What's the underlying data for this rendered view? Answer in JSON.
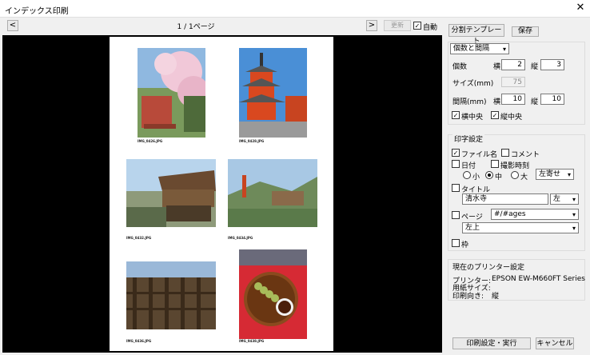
{
  "window": {
    "title": "インデックス印刷"
  },
  "toolbar": {
    "prev": "<",
    "next": ">",
    "page_info": "1 / 1ページ",
    "update": "更新",
    "auto": "自動",
    "auto_checked": true
  },
  "thumbs": [
    {
      "caption": "IMG_0426.JPG"
    },
    {
      "caption": "IMG_0428.JPG"
    },
    {
      "caption": "IMG_0432.JPG"
    },
    {
      "caption": "IMG_0434.JPG"
    },
    {
      "caption": "IMG_0436.JPG"
    },
    {
      "caption": "IMG_0438.JPG"
    }
  ],
  "panel": {
    "split_template": "分割テンプレート",
    "save": "保存",
    "mode": "個数と間隔",
    "count_label": "個数",
    "h_label": "横",
    "v_label": "縦",
    "count_h": "2",
    "count_v": "3",
    "size_label": "サイズ(mm)",
    "size_value": "75",
    "gap_label": "間隔(mm)",
    "gap_h": "10",
    "gap_v": "10",
    "center_h": "横中央",
    "center_v": "縦中央"
  },
  "print": {
    "group": "印字設定",
    "filename": "ファイル名",
    "comment": "コメント",
    "date": "日付",
    "datetime": "撮影時刻",
    "small": "小",
    "medium": "中",
    "large": "大",
    "align": "左寄せ",
    "title": "タイトル",
    "title_value": "清水寺",
    "title_align": "左",
    "page": "ページ",
    "page_format": "#/#ages",
    "page_pos": "左上",
    "frame": "枠"
  },
  "printer": {
    "group": "現在のプリンター設定",
    "printer_label": "プリンター:",
    "printer_value": "EPSON EW-M660FT Series",
    "paper_label": "用紙サイズ:",
    "paper_value": "",
    "orient_label": "印刷向き:",
    "orient_value": "縦"
  },
  "footer": {
    "print_run": "印刷設定・実行",
    "cancel": "キャンセル"
  }
}
